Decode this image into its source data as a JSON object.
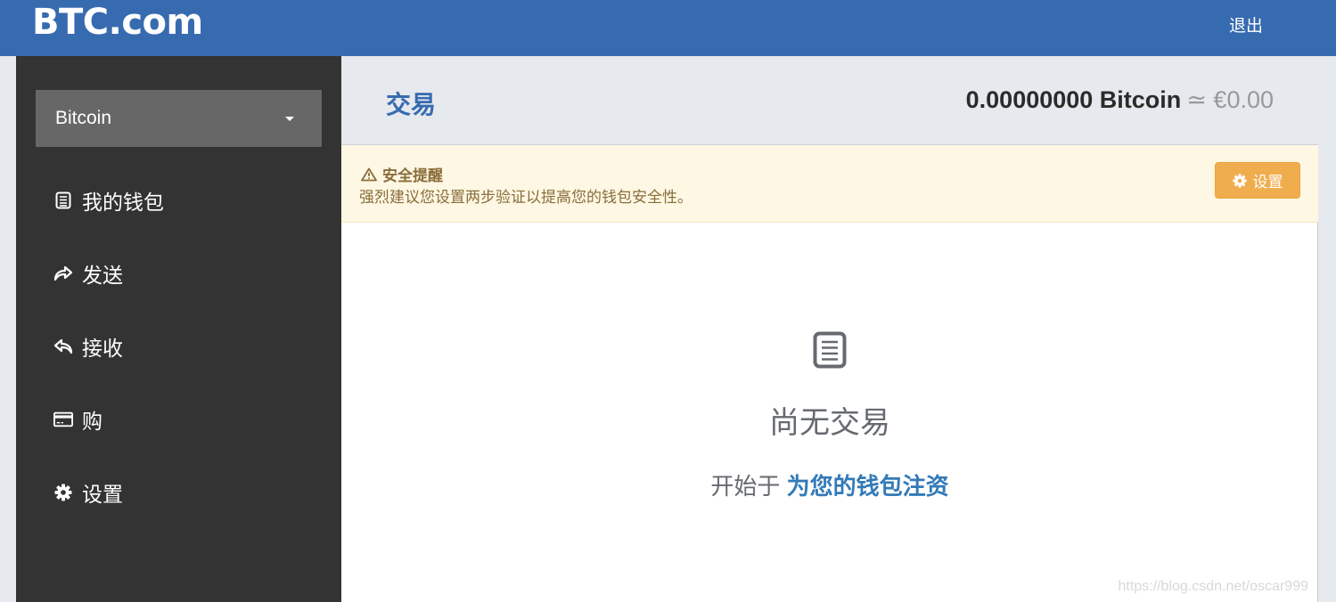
{
  "topbar": {
    "logo": "BTC.com",
    "logout_label": "退出",
    "color": "#376bb0"
  },
  "sidebar": {
    "coin_select": {
      "value": "Bitcoin",
      "icon": "caret-down-icon"
    },
    "items": [
      {
        "label": "我的钱包",
        "icon": "document-list-icon"
      },
      {
        "label": "发送",
        "icon": "share-arrow-icon"
      },
      {
        "label": "接收",
        "icon": "reply-arrow-icon"
      },
      {
        "label": "购",
        "icon": "credit-card-icon"
      },
      {
        "label": "设置",
        "icon": "gear-icon"
      }
    ]
  },
  "main": {
    "title": "交易",
    "balance": {
      "amount": "0.00000000 Bitcoin",
      "approx": "≃ €0.00"
    },
    "alert": {
      "icon": "warning-triangle-icon",
      "title": "安全提醒",
      "text": "强烈建议您设置两步验证以提高您的钱包安全性。",
      "button_label": "设置",
      "button_icon": "gear-icon",
      "button_color": "#f0ad4e"
    },
    "empty_state": {
      "icon": "document-list-icon",
      "title": "尚无交易",
      "subtitle_prefix": "开始于",
      "subtitle_link": "为您的钱包注资"
    }
  },
  "watermark": "https://blog.csdn.net/oscar999"
}
